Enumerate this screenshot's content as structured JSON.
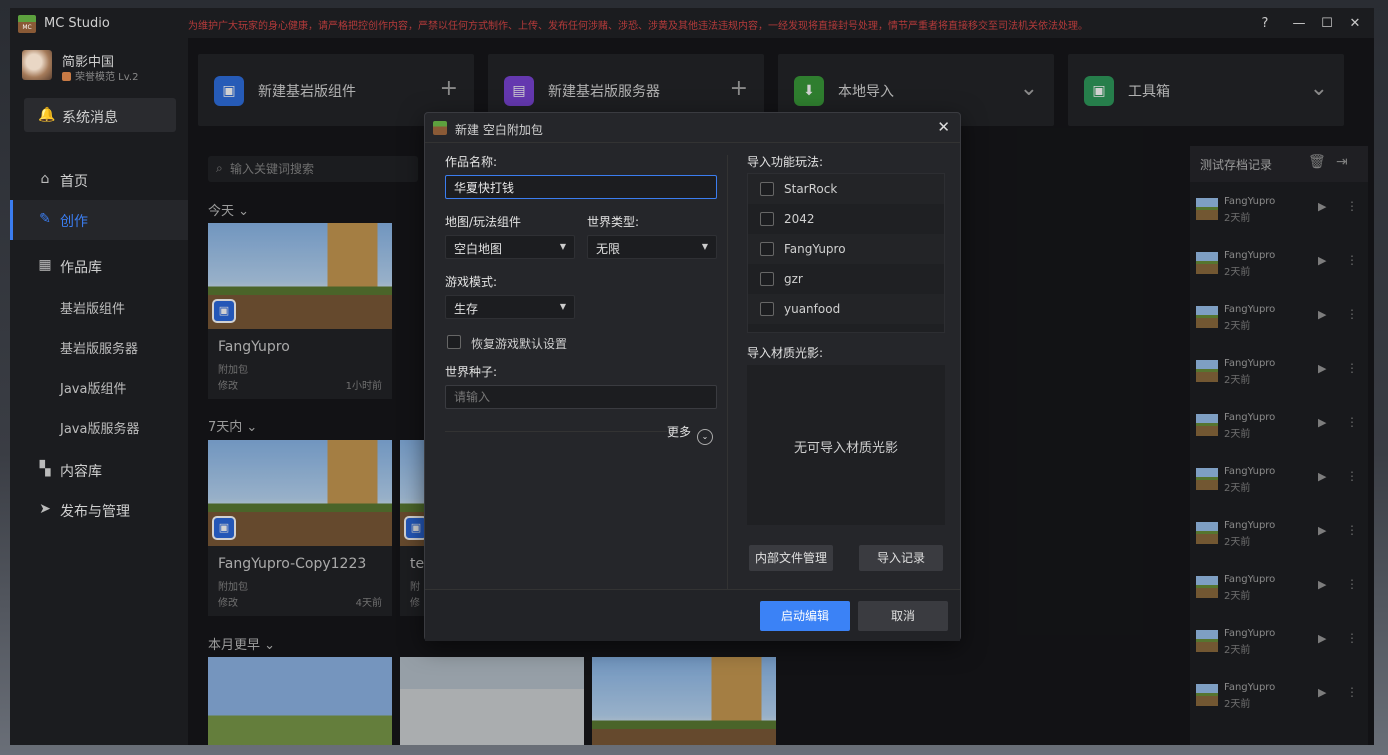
{
  "app": {
    "title": "MC Studio",
    "notice": "为维护广大玩家的身心健康，请严格把控创作内容，严禁以任何方式制作、上传、发布任何涉赌、涉恐、涉黄及其他违法违规内容，一经发现将直接封号处理，情节严重者将直接移交至司法机关依法处理。",
    "window": {
      "help": "?",
      "minimize": "—",
      "maximize": "☐",
      "close": "✕"
    }
  },
  "profile": {
    "name": "简影中国",
    "level": "荣誉模范 Lv.2"
  },
  "sidebar": {
    "sysmsg": "系统消息",
    "items": [
      {
        "label": "首页",
        "icon": "home-icon"
      },
      {
        "label": "创作",
        "icon": "edit-icon"
      },
      {
        "label": "作品库",
        "icon": "library-icon"
      },
      {
        "label": "内容库",
        "icon": "grid-icon"
      },
      {
        "label": "发布与管理",
        "icon": "send-icon"
      }
    ],
    "subitems": [
      "基岩版组件",
      "基岩版服务器",
      "Java版组件",
      "Java版服务器"
    ]
  },
  "topcards": [
    {
      "label": "新建基岩版组件",
      "action": "+"
    },
    {
      "label": "新建基岩版服务器",
      "action": "+"
    },
    {
      "label": "本地导入",
      "action": "⌄"
    },
    {
      "label": "工具箱",
      "action": "⌄"
    }
  ],
  "search": {
    "placeholder": "输入关键词搜索"
  },
  "sections": {
    "today": "今天 ⌄",
    "week": "7天内 ⌄",
    "month": "本月更早 ⌄"
  },
  "cards": [
    {
      "name": "FangYupro",
      "type": "附加包",
      "meta": "修改",
      "time": "1小时前"
    },
    {
      "name": "FangYupro-Copy1223",
      "type": "附加包",
      "meta": "修改",
      "time": "4天前"
    },
    {
      "name": "te",
      "type": "附",
      "meta": "修",
      "time": ""
    }
  ],
  "rpanel": {
    "title": "测试存档记录",
    "items": [
      {
        "name": "FangYupro",
        "date": "2天前"
      },
      {
        "name": "FangYupro",
        "date": "2天前"
      },
      {
        "name": "FangYupro",
        "date": "2天前"
      },
      {
        "name": "FangYupro",
        "date": "2天前"
      },
      {
        "name": "FangYupro",
        "date": "2天前"
      },
      {
        "name": "FangYupro",
        "date": "2天前"
      },
      {
        "name": "FangYupro",
        "date": "2天前"
      },
      {
        "name": "FangYupro",
        "date": "2天前"
      },
      {
        "name": "FangYupro",
        "date": "2天前"
      },
      {
        "name": "FangYupro",
        "date": "2天前"
      }
    ]
  },
  "dialog": {
    "title": "新建 空白附加包",
    "name_label": "作品名称:",
    "name_value": "华夏快打钱",
    "map_label": "地图/玩法组件",
    "map_value": "空白地图",
    "world_type_label": "世界类型:",
    "world_type_value": "无限",
    "mode_label": "游戏模式:",
    "mode_value": "生存",
    "restore_label": "恢复游戏默认设置",
    "seed_label": "世界种子:",
    "seed_placeholder": "请输入",
    "more_label": "更多",
    "import_gameplay_label": "导入功能玩法:",
    "gameplay_items": [
      "StarRock",
      "2042",
      "FangYupro",
      "gzr",
      "yuanfood"
    ],
    "import_texture_label": "导入材质光影:",
    "no_texture": "无可导入材质光影",
    "internal_files": "内部文件管理",
    "import_record": "导入记录",
    "start": "启动编辑",
    "cancel": "取消"
  }
}
